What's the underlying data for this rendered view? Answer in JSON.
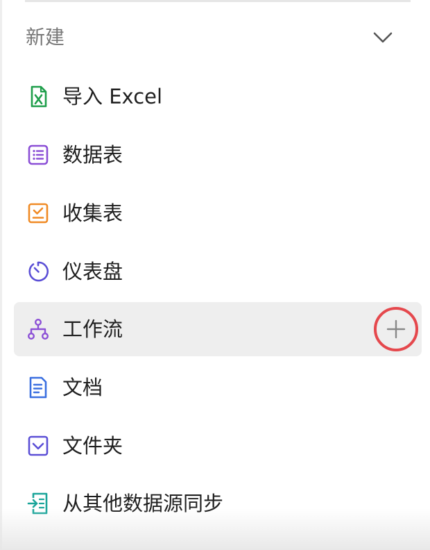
{
  "header": {
    "title": "新建",
    "toggle_icon": "chevron-down-icon"
  },
  "menu": {
    "items": [
      {
        "label": "导入 Excel",
        "icon": "excel-icon",
        "color": "#1e9e4a"
      },
      {
        "label": "数据表",
        "icon": "table-icon",
        "color": "#8b4fd6"
      },
      {
        "label": "收集表",
        "icon": "form-icon",
        "color": "#f08a24"
      },
      {
        "label": "仪表盘",
        "icon": "dashboard-icon",
        "color": "#5b4fd6"
      },
      {
        "label": "工作流",
        "icon": "workflow-icon",
        "color": "#8b4fd6",
        "hovered": true,
        "action_icon": "plus-icon"
      },
      {
        "label": "文档",
        "icon": "document-icon",
        "color": "#3a6fe0"
      },
      {
        "label": "文件夹",
        "icon": "folder-icon",
        "color": "#5b4fd6"
      },
      {
        "label": "从其他数据源同步",
        "icon": "sync-icon",
        "color": "#1aa59a"
      }
    ]
  },
  "colors": {
    "hover_background": "#eeeeee",
    "highlight_ring": "#e5484d",
    "label_text": "#1f1f1f",
    "header_text": "#777777"
  }
}
